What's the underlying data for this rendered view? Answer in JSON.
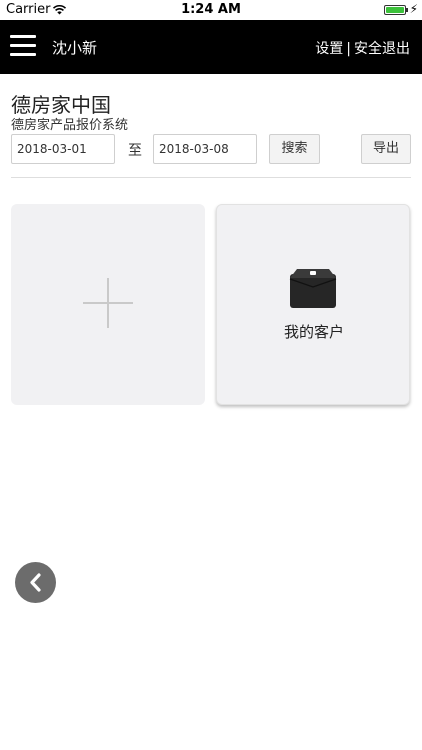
{
  "status_bar": {
    "carrier": "Carrier",
    "time": "1:24 AM"
  },
  "nav": {
    "user_name": "沈小新",
    "settings": "设置",
    "separator": "|",
    "logout": "安全退出"
  },
  "company": {
    "name": "德房家中国",
    "system": "德房家产品报价系统"
  },
  "search": {
    "date_from": "2018-03-01",
    "to_label": "至",
    "date_to": "2018-03-08",
    "search_label": "搜索",
    "export_label": "导出"
  },
  "tiles": {
    "customers_label": "我的客户"
  },
  "icons": {
    "menu": "hamburger-menu-icon",
    "add": "plus-icon",
    "customers": "wallet-icon",
    "back": "chevron-left-icon"
  },
  "colors": {
    "nav_bg": "#000000",
    "tile_bg": "#f1f1f3",
    "back_btn": "#6c6c6c",
    "battery": "#3cc13b"
  }
}
